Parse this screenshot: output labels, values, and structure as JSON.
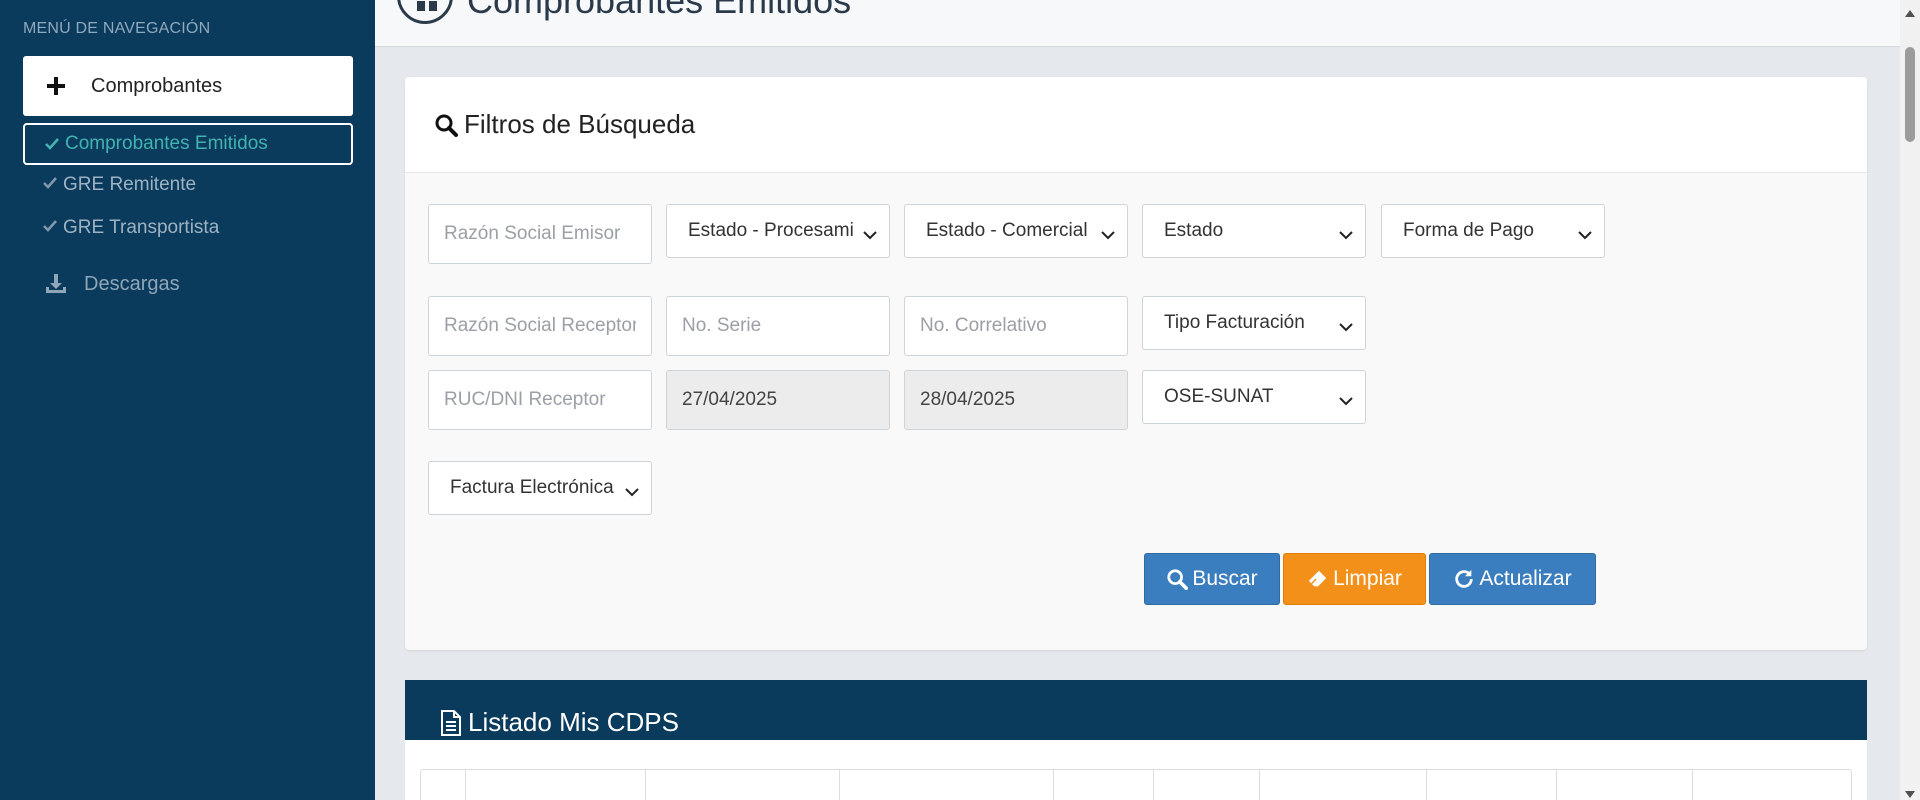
{
  "sidebar": {
    "header": "MENÚ DE NAVEGACIÓN",
    "group_label": "Comprobantes",
    "items": [
      {
        "label": "Comprobantes Emitidos"
      },
      {
        "label": "GRE Remitente"
      },
      {
        "label": "GRE Transportista"
      }
    ],
    "downloads_label": "Descargas"
  },
  "page": {
    "title": "Comprobantes Emitidos"
  },
  "filters": {
    "title": "Filtros de Búsqueda",
    "razon_social_emisor_placeholder": "Razón Social Emisor",
    "estado_procesamiento": "Estado - Procesami",
    "estado_comercial": "Estado - Comercial",
    "estado": "Estado",
    "forma_pago": "Forma de Pago",
    "razon_social_receptor_placeholder": "Razón Social Receptor",
    "no_serie_placeholder": "No. Serie",
    "no_correlativo_placeholder": "No. Correlativo",
    "tipo_facturacion": "Tipo Facturación",
    "ruc_dni_placeholder": "RUC/DNI Receptor",
    "fecha_inicio": "27/04/2025",
    "fecha_fin": "28/04/2025",
    "ose_sunat": "OSE-SUNAT",
    "tipo_comprobante": "Factura Electrónica",
    "buttons": {
      "buscar": "Buscar",
      "limpiar": "Limpiar",
      "actualizar": "Actualizar"
    }
  },
  "listing": {
    "title": "Listado Mis CDPS"
  },
  "colors": {
    "sidebar_bg": "#0a3a5c",
    "active_text": "#41b3b0",
    "primary_button": "#3a7ebf",
    "warning_button": "#f39019"
  },
  "icons": {
    "group": "plus-icon",
    "subitem": "check-icon",
    "downloads": "download-icon",
    "filters": "search-icon",
    "limpiar": "eraser-icon",
    "actualizar": "refresh-icon",
    "listing": "document-icon"
  }
}
